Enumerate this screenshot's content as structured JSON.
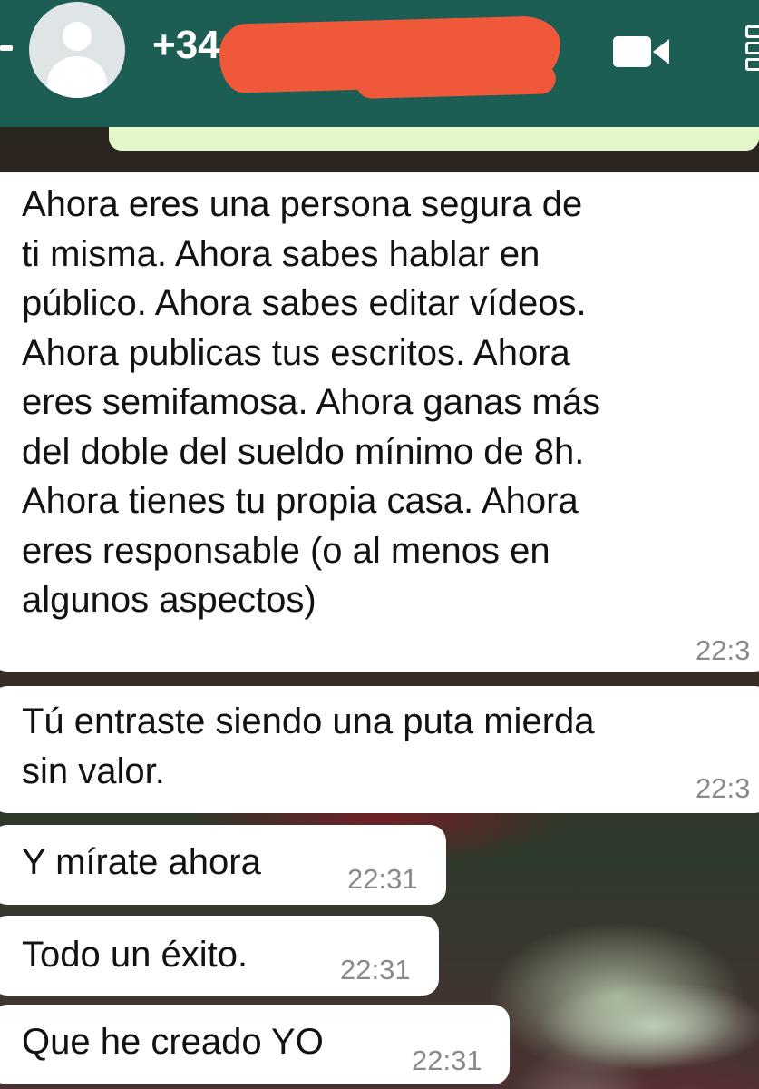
{
  "header": {
    "contact_name": "+34",
    "background_color": "#1c5d54",
    "icons": [
      "back-arrow-icon",
      "avatar-placeholder-icon",
      "video-call-icon",
      "menu-icon"
    ]
  },
  "messages": [
    {
      "text": "Ahora eres una persona segura de\nti misma. Ahora sabes hablar en\npúblico. Ahora sabes editar vídeos.\nAhora publicas tus escritos. Ahora\neres semifamosa. Ahora ganas más\ndel doble del sueldo mínimo de 8h.\nAhora tienes tu propia casa. Ahora\neres responsable (o al menos en\nalgunos aspectos)",
      "time": "22:3"
    },
    {
      "text": "Tú entraste siendo una puta mierda\nsin valor.",
      "time": "22:3"
    },
    {
      "text": "Y mírate ahora",
      "time": "22:31"
    },
    {
      "text": "Todo un éxito.",
      "time": "22:31"
    },
    {
      "text": "Que he creado YO",
      "time": "22:31"
    }
  ],
  "colors": {
    "bubble": "#ffffff",
    "time_text": "#8a8a8a",
    "redaction": "#f0583a",
    "sent_bubble_edge": "#e4f7c9"
  }
}
